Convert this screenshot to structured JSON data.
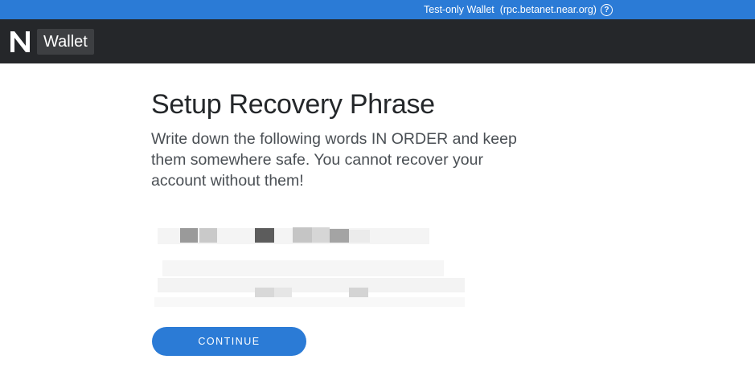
{
  "banner": {
    "network_label": "Test-only Wallet",
    "rpc_url": "(rpc.betanet.near.org)",
    "help_icon": "help-circle-icon"
  },
  "navbar": {
    "logo_icon": "near-logo-icon",
    "wallet_label": "Wallet"
  },
  "main": {
    "title": "Setup Recovery Phrase",
    "instructions": "Write down the following words IN ORDER and keep them somewhere safe. You cannot recover your account without them!",
    "continue_label": "CONTINUE"
  },
  "colors": {
    "accent": "#2b7bd6",
    "navbar": "#25272a",
    "title_text": "#24272a",
    "body_text": "#4a4f54"
  }
}
